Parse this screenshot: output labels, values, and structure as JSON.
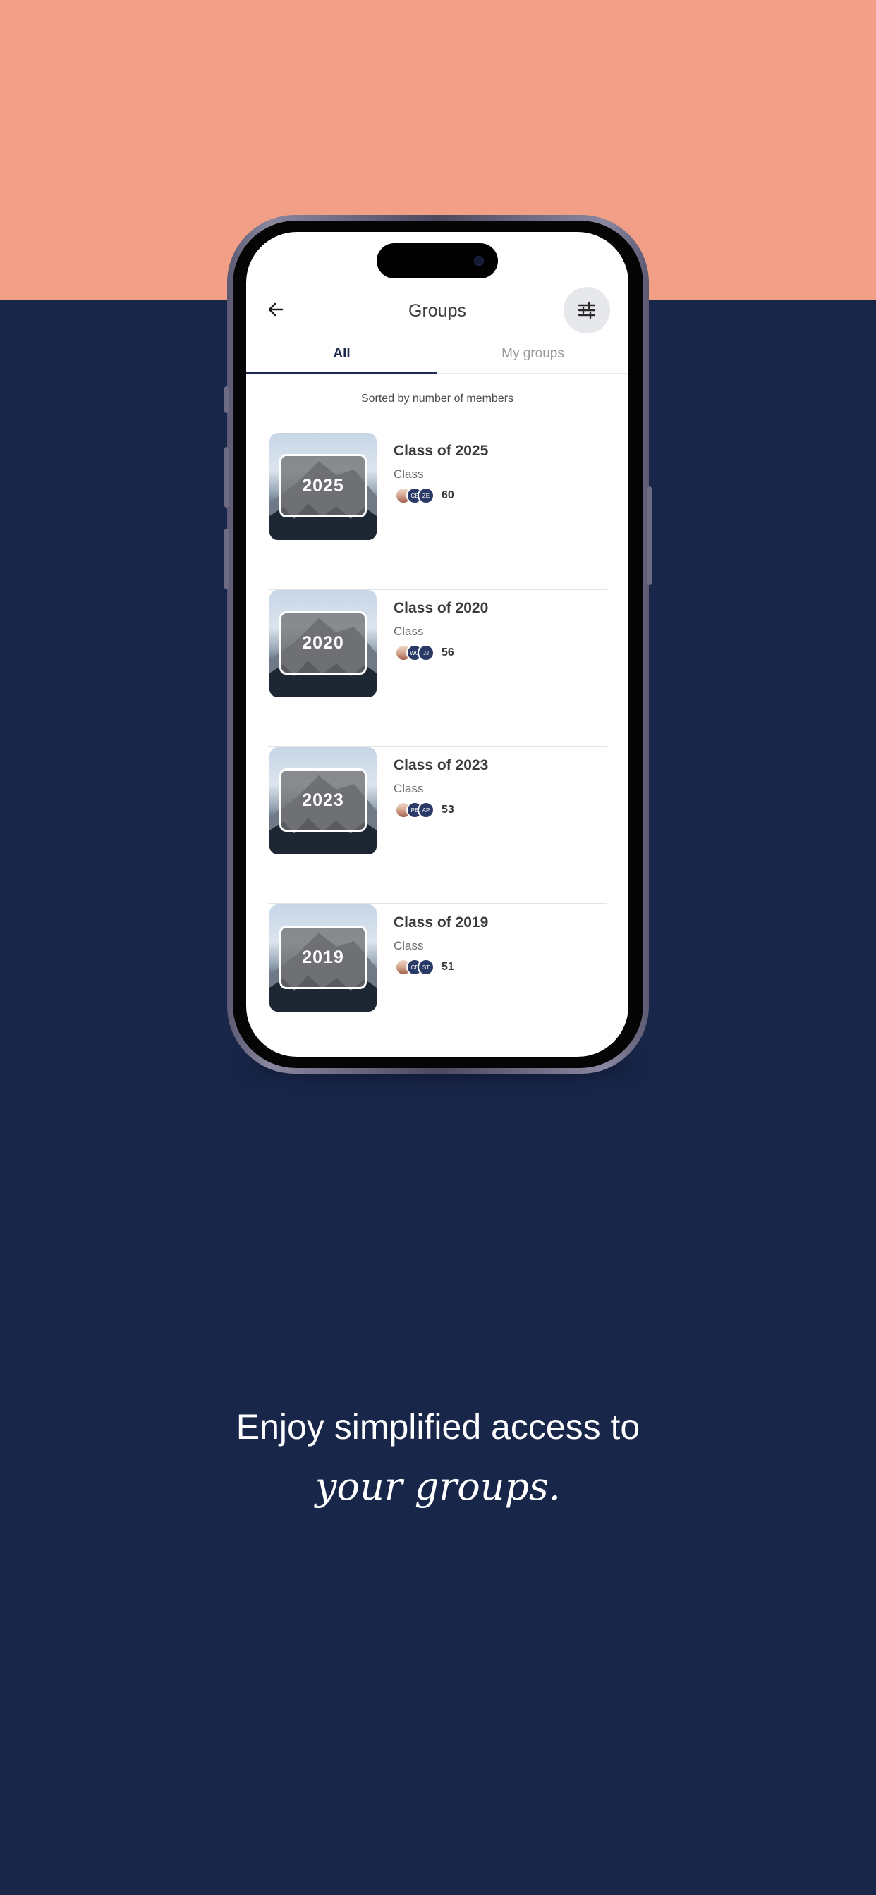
{
  "colors": {
    "top_band": "#f29f88",
    "background": "#18264a",
    "accent": "#1b2a4e"
  },
  "header": {
    "title": "Groups",
    "back_icon": "arrow-left-icon",
    "filter_icon": "sliders-icon"
  },
  "tabs": [
    {
      "label": "All",
      "active": true
    },
    {
      "label": "My groups",
      "active": false
    }
  ],
  "sort_note": "Sorted by number of members",
  "groups": [
    {
      "name": "Class of 2025",
      "type": "Class",
      "badge": "2025",
      "avatar_initials": [
        "CE",
        "ZE"
      ],
      "member_count": "60"
    },
    {
      "name": "Class of 2020",
      "type": "Class",
      "badge": "2020",
      "avatar_initials": [
        "WG",
        "JJ"
      ],
      "member_count": "56"
    },
    {
      "name": "Class of 2023",
      "type": "Class",
      "badge": "2023",
      "avatar_initials": [
        "PB",
        "AP"
      ],
      "member_count": "53"
    },
    {
      "name": "Class of 2019",
      "type": "Class",
      "badge": "2019",
      "avatar_initials": [
        "CE",
        "ST"
      ],
      "member_count": "51"
    }
  ],
  "tagline": {
    "line1": "Enjoy simplified access to",
    "line2": "your groups."
  }
}
